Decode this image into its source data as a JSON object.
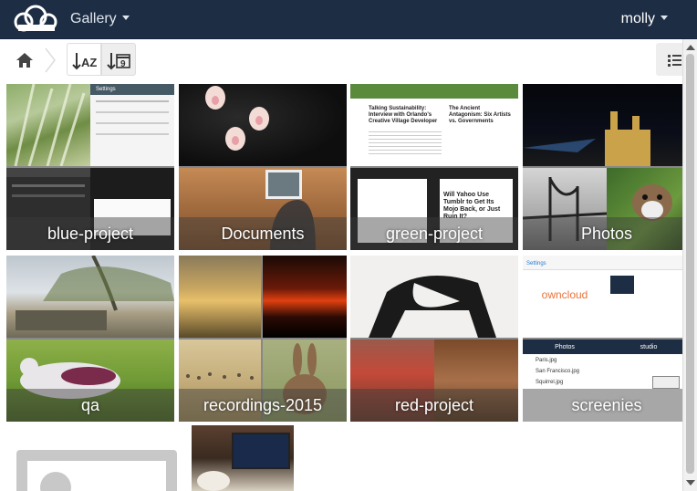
{
  "header": {
    "app_name": "Gallery",
    "user_name": "molly",
    "background": "#1d2d44"
  },
  "controls": {
    "home_icon": "home-icon",
    "sort_name_icon": "sort-alpha-icon",
    "sort_name_text": "AZ",
    "sort_date_icon": "sort-date-icon",
    "sort_date_text": "9",
    "view_icon": "list-view-icon"
  },
  "albums": [
    {
      "name": "blue-project"
    },
    {
      "name": "Documents"
    },
    {
      "name": "green-project"
    },
    {
      "name": "Photos"
    },
    {
      "name": "qa"
    },
    {
      "name": "recordings-2015"
    },
    {
      "name": "red-project"
    },
    {
      "name": "screenies"
    }
  ],
  "thumbnails": {
    "blue_project_shot_title": "Settings",
    "green_project_headline_1": "Talking Sustainability: Interview with Orlando's Creative Village Developer",
    "green_project_headline_2": "The Ancient Antagonism: Six Artists vs. Governments",
    "green_project_headline_3": "Will Yahoo Use Tumblr to Get Its Mojo Back, or Just Ruin It?",
    "screenies_settings_title": "Settings",
    "screenies_brand": "owncloud",
    "screenies_photos_title": "Photos",
    "screenies_files": [
      "Paris.jpg",
      "San Francisco.jpg",
      "Squirrel.jpg"
    ],
    "screenies_studio_title": "studio"
  }
}
